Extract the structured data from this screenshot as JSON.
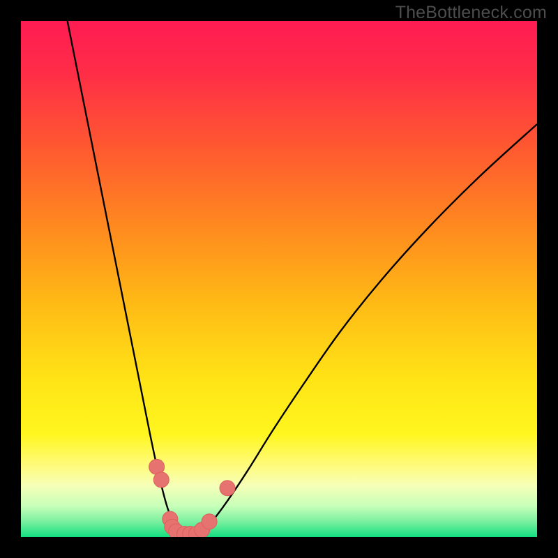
{
  "watermark": "TheBottleneck.com",
  "colors": {
    "frame": "#000000",
    "gradient_stops": [
      {
        "offset": 0.0,
        "color": "#ff1b52"
      },
      {
        "offset": 0.1,
        "color": "#ff2d47"
      },
      {
        "offset": 0.25,
        "color": "#ff5a30"
      },
      {
        "offset": 0.4,
        "color": "#ff8a1f"
      },
      {
        "offset": 0.55,
        "color": "#ffbb15"
      },
      {
        "offset": 0.7,
        "color": "#ffe516"
      },
      {
        "offset": 0.8,
        "color": "#fff61f"
      },
      {
        "offset": 0.86,
        "color": "#fffb7a"
      },
      {
        "offset": 0.9,
        "color": "#f6ffb8"
      },
      {
        "offset": 0.94,
        "color": "#c7ffb9"
      },
      {
        "offset": 0.97,
        "color": "#7af09f"
      },
      {
        "offset": 1.0,
        "color": "#13e080"
      }
    ],
    "curve": "#000000",
    "marker_fill": "#e6736f",
    "marker_stroke": "#da5f5c"
  },
  "chart_data": {
    "type": "line",
    "title": "",
    "xlabel": "",
    "ylabel": "",
    "xlim": [
      0,
      100
    ],
    "ylim": [
      0,
      100
    ],
    "grid": false,
    "series": [
      {
        "name": "left-branch",
        "x": [
          9,
          11,
          13,
          15,
          17,
          19,
          21,
          23,
          25,
          26.5,
          28,
          29,
          30,
          31
        ],
        "y": [
          100,
          90,
          80,
          70,
          60,
          50,
          40,
          30,
          20,
          13,
          7,
          4,
          2,
          1
        ]
      },
      {
        "name": "right-branch",
        "x": [
          35,
          37,
          40,
          44,
          49,
          55,
          62,
          70,
          79,
          89,
          100
        ],
        "y": [
          1,
          3,
          7,
          13,
          21,
          30,
          40,
          50,
          60,
          70,
          80
        ]
      }
    ],
    "markers": [
      {
        "x": 26.3,
        "y": 13.6
      },
      {
        "x": 27.2,
        "y": 11.1
      },
      {
        "x": 28.9,
        "y": 3.5
      },
      {
        "x": 29.3,
        "y": 2.0
      },
      {
        "x": 30.1,
        "y": 1.1
      },
      {
        "x": 31.7,
        "y": 0.6
      },
      {
        "x": 32.8,
        "y": 0.6
      },
      {
        "x": 34.0,
        "y": 0.6
      },
      {
        "x": 35.1,
        "y": 1.4
      },
      {
        "x": 36.5,
        "y": 3.0
      },
      {
        "x": 40.0,
        "y": 9.5
      }
    ],
    "marker_radius_px": 11
  }
}
